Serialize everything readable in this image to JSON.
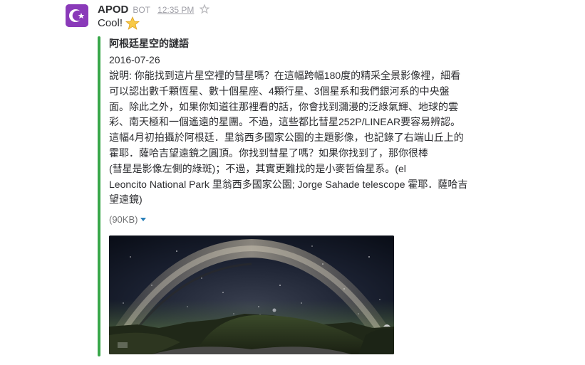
{
  "message": {
    "sender": "APOD",
    "badge": "BOT",
    "time": "12:35 PM",
    "text": "Cool!",
    "emoji": "star-emoji",
    "avatar_icon": "star-and-crescent-icon",
    "avatar_color": "#8a3ab9"
  },
  "attachment": {
    "accent_color": "#39a74a",
    "title": "阿根廷星空的謎語",
    "date": "2016-07-26",
    "description_lines": [
      "說明: 你能找到這片星空裡的彗星嗎？在這幅跨幅180度的精采全景影像裡，細看",
      "可以認出數千顆恆星、數十個星座、4顆行星、3個星系和我們銀河系的中央盤",
      "面。除此之外，如果你知道往那裡看的話，你會找到瀰漫的泛綠氣輝、地球的雲",
      "彩、南天極和一個遙遠的星團。不過，這些都比彗星252P/LINEAR要容易辨認。",
      "這幅4月初拍攝於阿根廷．里翁西多國家公園的主題影像，也記錄了右端山丘上的",
      "霍耶．薩哈吉望遠鏡之圓頂。你找到彗星了嗎？如果你找到了，那你很棒",
      "(彗星是影像左側的綠斑)；不過，其實更難找的是小麥哲倫星系。(el",
      "Leoncito National Park 里翁西多國家公園; Jorge Sahade telescope 霍耶．薩哈吉",
      "望遠鏡)"
    ],
    "file_size": "(90KB)",
    "image_alt": "Milky Way arch panorama over Argentine hills"
  }
}
